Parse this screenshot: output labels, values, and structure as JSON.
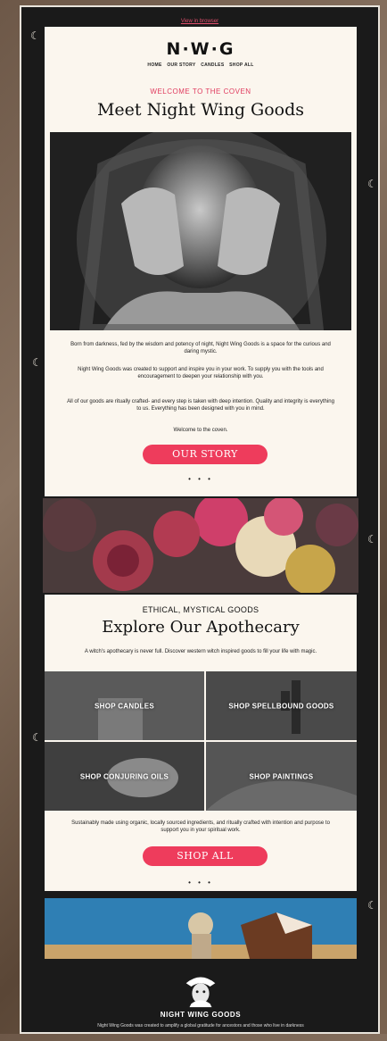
{
  "topbar": {
    "view_in_browser": "View in browser"
  },
  "header": {
    "logo": "N·W·G",
    "nav": [
      "HOME",
      "OUR STORY",
      "CANDLES",
      "SHOP ALL"
    ]
  },
  "intro": {
    "eyebrow": "WELCOME TO THE COVEN",
    "title": "Meet Night Wing Goods",
    "paragraphs": [
      "Born from darkness, fed by the wisdom and potency of night, Night Wing Goods is a space for the curious and daring mystic.",
      "Night Wing Goods was created to support and inspire you in your work. To supply you with the tools and encouragement to deepen your relationship with you.",
      "All of our goods are ritually crafted- and every step is taken with deep intention. Quality and integrity is everything to us. Everything has been designed with you in mind.",
      "Welcome to the coven."
    ],
    "cta": "OUR STORY",
    "divider": "• • •"
  },
  "apothecary": {
    "eyebrow": "ETHICAL, MYSTICAL GOODS",
    "title": "Explore Our Apothecary",
    "description": "A witch's apothecary is never full. Discover western witch inspired goods to fill your life with magic.",
    "tiles": [
      {
        "label": "SHOP CANDLES"
      },
      {
        "label": "SHOP SPELLBOUND GOODS"
      },
      {
        "label": "SHOP CONJURING OILS"
      },
      {
        "label": "SHOP PAINTINGS"
      }
    ],
    "note": "Sustainably made using organic, locally sourced ingredients, and ritually crafted with intention and purpose to support you in your spiritual work.",
    "cta": "SHOP ALL",
    "divider": "• • •"
  },
  "footer": {
    "brand": "NIGHT WING GOODS",
    "text": "Night Wing Goods was created to amplify a global gratitude for ancestors and those who live in darkness"
  },
  "icons": [
    "crescent-moon-icon",
    "witch-logo-icon"
  ],
  "colors": {
    "accent": "#ee3c5c",
    "cream": "#fbf6ee",
    "frame": "#1a1a1a"
  }
}
